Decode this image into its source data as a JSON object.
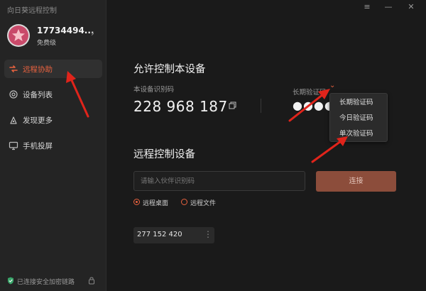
{
  "app": {
    "title": "向日葵远程控制"
  },
  "profile": {
    "username": "17734494...",
    "tier": "免费级"
  },
  "sidebar": {
    "items": [
      {
        "label": "远程协助",
        "active": true
      },
      {
        "label": "设备列表",
        "active": false
      },
      {
        "label": "发现更多",
        "active": false
      },
      {
        "label": "手机投屏",
        "active": false
      }
    ],
    "status_text": "已连接安全加密链路"
  },
  "allow_section": {
    "title": "允许控制本设备",
    "device_id_label": "本设备识别码",
    "device_id": "228 968 187",
    "code_type_label": "长期验证码",
    "password_mask": "●●●●"
  },
  "code_menu": {
    "options": [
      "长期验证码",
      "今日验证码",
      "单次验证码"
    ]
  },
  "remote_section": {
    "title": "远程控制设备",
    "input_placeholder": "请输入伙伴识别码",
    "connect_label": "连接",
    "modes": [
      {
        "label": "远程桌面",
        "checked": true
      },
      {
        "label": "远程文件",
        "checked": false
      }
    ],
    "history": [
      {
        "id": "277 152 420"
      }
    ]
  },
  "colors": {
    "accent": "#e8623f",
    "connect": "#8c4d3b",
    "arrow": "#e0241b"
  }
}
